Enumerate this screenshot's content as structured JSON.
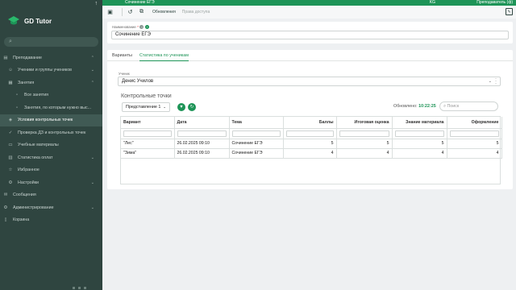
{
  "topbar": {
    "title": "Сочинение ЕГЭ",
    "lang": "KG",
    "user": "Преподаватель (ф)"
  },
  "toolbar": {
    "updates_label": "Обновления",
    "access_label": "Права доступа"
  },
  "sidebar": {
    "logo_text": "GD Tutor",
    "items": [
      {
        "label": "Преподавание",
        "icon": "book-icon"
      },
      {
        "label": "Ученики и группы учеников",
        "icon": "people-icon"
      },
      {
        "label": "Занятия",
        "icon": "calendar-icon"
      },
      {
        "label": "Все занятия",
        "icon": "list-icon"
      },
      {
        "label": "Занятия, по которым нужно выс...",
        "icon": "list-icon"
      },
      {
        "label": "Условия контрольных точек",
        "icon": "checkpoint-icon"
      },
      {
        "label": "Проверка ДЗ и контрольных точек",
        "icon": "check-icon"
      },
      {
        "label": "Учебные материалы",
        "icon": "folder-icon"
      },
      {
        "label": "Статистика оплат",
        "icon": "chart-icon"
      },
      {
        "label": "Избранное",
        "icon": "star-icon"
      },
      {
        "label": "Настройки",
        "icon": "gear-icon"
      },
      {
        "label": "Сообщения",
        "icon": "message-icon"
      },
      {
        "label": "Администрирование",
        "icon": "admin-icon"
      },
      {
        "label": "Корзина",
        "icon": "trash-icon"
      }
    ]
  },
  "name_field": {
    "label": "Наименование",
    "value": "Сочинение ЕГЭ"
  },
  "tabs": {
    "variants": "Варианты",
    "stats": "Статистика по ученикам"
  },
  "student": {
    "label": "Ученик",
    "value": "Денис Училов"
  },
  "checkpoints": {
    "title": "Контрольные точки",
    "view_value": "Представление 1",
    "updated_label": "Обновлено:",
    "updated_time": "10:22:25",
    "search_placeholder": "Поиск"
  },
  "table": {
    "columns": [
      "Вариант",
      "Дата",
      "Тема",
      "Баллы",
      "Итоговая оценка",
      "Знание материала",
      "Оформление"
    ],
    "rows": [
      [
        "\"Лес\"",
        "26.02.2025 09:10",
        "Сочинение ЕГЭ",
        "5",
        "5",
        "5",
        "5"
      ],
      [
        "\"Зима\"",
        "26.02.2025 09:10",
        "Сочинение ЕГЭ",
        "4",
        "4",
        "4",
        "4"
      ]
    ]
  },
  "colors": {
    "accent": "#1d9457",
    "sidebar_bg": "#2f4540"
  }
}
